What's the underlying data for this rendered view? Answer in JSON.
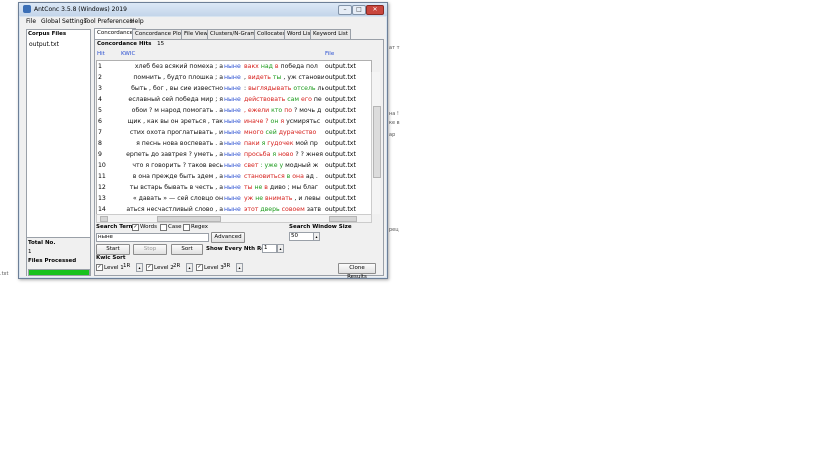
{
  "window": {
    "title": "AntConc 3.5.8 (Windows) 2019",
    "controls": {
      "minimize": "–",
      "maximize": "□",
      "close": "✕"
    }
  },
  "menu": [
    "File",
    "Global Settings",
    "Tool Preferences",
    "Help"
  ],
  "left_pane": {
    "corpus_header": "Corpus Files",
    "files": [
      "output.txt"
    ],
    "total_label": "Total No.",
    "total_value": "1",
    "processed_label": "Files Processed",
    "progress_percent": 100
  },
  "tabs": [
    "Concordance",
    "Concordance Plot",
    "File View",
    "Clusters/N-Grams",
    "Collocates",
    "Word List",
    "Keyword List"
  ],
  "concordance": {
    "hits_label": "Concordance Hits",
    "hits_value": "15",
    "col_hit": "Hit",
    "col_kwic": "KWIC",
    "col_file": "File",
    "rows": [
      {
        "n": "1",
        "left": "хлеб без всякий помеха ; а",
        "kw": "ныне",
        "right": [
          [
            "вакх ",
            "red"
          ],
          [
            "над ",
            "green"
          ],
          [
            "в ",
            "red"
          ],
          [
            "победа пол",
            "black"
          ]
        ],
        "file": "output.txt"
      },
      {
        "n": "2",
        "left": "помнить , будто плошка ; а",
        "kw": "ныне",
        "right": [
          [
            ", ",
            "black"
          ],
          [
            "видеть ",
            "red"
          ],
          [
            "ты ",
            "green"
          ],
          [
            ", уж ",
            "black"
          ],
          [
            "станови",
            "black"
          ]
        ],
        "file": "output.txt"
      },
      {
        "n": "3",
        "left": "быть , бог , вы сие известно",
        "kw": "ныне",
        "right": [
          [
            ": ",
            "black"
          ],
          [
            "выглядывать ",
            "red"
          ],
          [
            "отсель ",
            "green"
          ],
          [
            "ль",
            "black"
          ]
        ],
        "file": "output.txt"
      },
      {
        "n": "4",
        "left": "еславный сей победа мир ; я",
        "kw": "ныне",
        "right": [
          [
            "действовать ",
            "red"
          ],
          [
            "сам ",
            "green"
          ],
          [
            "его ",
            "red"
          ],
          [
            "пе",
            "black"
          ]
        ],
        "file": "output.txt"
      },
      {
        "n": "5",
        "left": "обои ? м народ помогать . а",
        "kw": "ныне",
        "right": [
          [
            ", ежели ",
            "red"
          ],
          [
            "кто ",
            "green"
          ],
          [
            "по ",
            "red"
          ],
          [
            "? мочь д",
            "black"
          ]
        ],
        "file": "output.txt"
      },
      {
        "n": "6",
        "left": "щик , как вы он зреться , так",
        "kw": "ныне",
        "right": [
          [
            "иначе ? ",
            "red"
          ],
          [
            "он ",
            "green"
          ],
          [
            "я ",
            "red"
          ],
          [
            "усмирятьс",
            "black"
          ]
        ],
        "file": "output.txt"
      },
      {
        "n": "7",
        "left": "стих охота проглатывать , и",
        "kw": "ныне",
        "right": [
          [
            "много ",
            "red"
          ],
          [
            "сей ",
            "green"
          ],
          [
            "дурачество ",
            "red"
          ],
          [
            "",
            "black"
          ]
        ],
        "file": "output.txt"
      },
      {
        "n": "8",
        "left": "я песнь нова воспевать . а",
        "kw": "ныне",
        "right": [
          [
            "паки ",
            "red"
          ],
          [
            "я ",
            "green"
          ],
          [
            "гудочек ",
            "red"
          ],
          [
            "мой пр",
            "black"
          ]
        ],
        "file": "output.txt"
      },
      {
        "n": "9",
        "left": "ерпеть до завтрея ? уметь , а",
        "kw": "ныне",
        "right": [
          [
            "просьба ",
            "red"
          ],
          [
            "я ",
            "green"
          ],
          [
            "ново ",
            "red"
          ],
          [
            "? ? жнея",
            "black"
          ]
        ],
        "file": "output.txt"
      },
      {
        "n": "10",
        "left": "что я говорить ? таков весь",
        "kw": "ныне",
        "right": [
          [
            "свет ",
            "red"
          ],
          [
            ": уже у ",
            "green"
          ],
          [
            "модный ж",
            "black"
          ]
        ],
        "file": "output.txt"
      },
      {
        "n": "11",
        "left": "в она прежде быть здем , а",
        "kw": "ныне",
        "right": [
          [
            "становиться ",
            "red"
          ],
          [
            "в ",
            "green"
          ],
          [
            "она ",
            "red"
          ],
          [
            "ад . ",
            "black"
          ]
        ],
        "file": "output.txt"
      },
      {
        "n": "12",
        "left": "ты встарь бывать в честь , а",
        "kw": "ныне",
        "right": [
          [
            "ты ",
            "red"
          ],
          [
            "не ",
            "green"
          ],
          [
            "в ",
            "red"
          ],
          [
            "диво ; мы благ",
            "black"
          ]
        ],
        "file": "output.txt"
      },
      {
        "n": "13",
        "left": "« давать » — сей словцо он",
        "kw": "ныне",
        "right": [
          [
            "уж ",
            "red"
          ],
          [
            "не ",
            "green"
          ],
          [
            "внимать ",
            "red"
          ],
          [
            ", и левы",
            "black"
          ]
        ],
        "file": "output.txt"
      },
      {
        "n": "14",
        "left": "аться несчастливый слово , а",
        "kw": "ныне",
        "right": [
          [
            "этот ",
            "red"
          ],
          [
            "дверь ",
            "green"
          ],
          [
            "совоем ",
            "red"
          ],
          [
            "затв",
            "black"
          ]
        ],
        "file": "output.txt"
      }
    ]
  },
  "search": {
    "term_label": "Search Term",
    "words_label": "Words",
    "case_label": "Case",
    "regex_label": "Regex",
    "term_value": "ныне",
    "advanced_label": "Advanced",
    "window_size_label": "Search Window Size",
    "window_size_value": "50",
    "start_label": "Start",
    "stop_label": "Stop",
    "sort_label": "Sort",
    "nth_row_label": "Show Every Nth Row",
    "nth_row_value": "1"
  },
  "kwic_sort": {
    "label": "Kwic Sort",
    "levels": [
      {
        "label": "Level 1",
        "value": "1R"
      },
      {
        "label": "Level 2",
        "value": "2R"
      },
      {
        "label": "Level 3",
        "value": "3R"
      }
    ],
    "clone_label": "Clone Results"
  },
  "background": {
    "desktop_text": ".txt",
    "side_fragments": [
      "ат т",
      "на !",
      "ке в",
      "ар",
      "рец"
    ]
  },
  "colors": {
    "red": "#d6201c",
    "green": "#1a9a1a",
    "blue": "#2a4fd1",
    "black": "#111111"
  }
}
